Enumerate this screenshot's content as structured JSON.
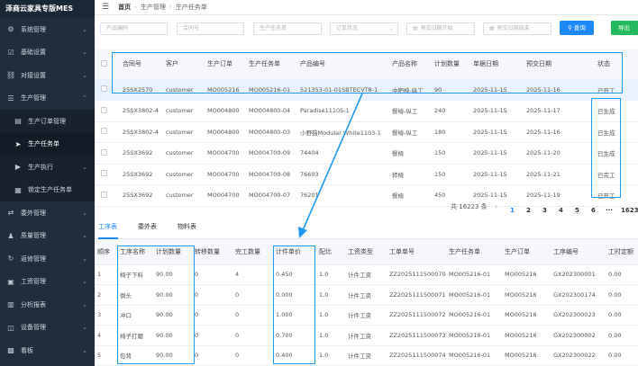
{
  "app": {
    "title": "泽商云家具专版MES"
  },
  "sidebar": {
    "items": [
      {
        "label": "系统管理",
        "icon": "gear-icon",
        "glyph": "⚙",
        "arrow": "⌄",
        "sub": false,
        "active": false
      },
      {
        "label": "基础设置",
        "icon": "checkbox-icon",
        "glyph": "☑",
        "arrow": "⌄",
        "sub": false,
        "active": false
      },
      {
        "label": "对接设置",
        "icon": "link-icon",
        "glyph": "⛓",
        "arrow": "⌄",
        "sub": false,
        "active": false
      },
      {
        "label": "生产管理",
        "icon": "layers-icon",
        "glyph": "☰",
        "arrow": "⌃",
        "sub": false,
        "active": false
      },
      {
        "label": "生产订单管理",
        "icon": "inbox-icon",
        "glyph": "▤",
        "arrow": "",
        "sub": true,
        "active": false
      },
      {
        "label": "生产任务单",
        "icon": "send-icon",
        "glyph": "➤",
        "arrow": "",
        "sub": true,
        "active": true
      },
      {
        "label": "生产执行",
        "icon": "play-circle-icon",
        "glyph": "▶",
        "arrow": "⌄",
        "sub": true,
        "active": false
      },
      {
        "label": "锁定生产任务单",
        "icon": "grid-icon",
        "glyph": "▦",
        "arrow": "",
        "sub": true,
        "active": false
      },
      {
        "label": "委外管理",
        "icon": "transfer-icon",
        "glyph": "⇄",
        "arrow": "⌄",
        "sub": false,
        "active": false
      },
      {
        "label": "质量管理",
        "icon": "user-check-icon",
        "glyph": "♟",
        "arrow": "⌄",
        "sub": false,
        "active": false
      },
      {
        "label": "返修管理",
        "icon": "refresh-icon",
        "glyph": "↻",
        "arrow": "⌄",
        "sub": false,
        "active": false
      },
      {
        "label": "工资管理",
        "icon": "wallet-icon",
        "glyph": "▣",
        "arrow": "⌄",
        "sub": false,
        "active": false
      },
      {
        "label": "分析报表",
        "icon": "chart-icon",
        "glyph": "▥",
        "arrow": "⌄",
        "sub": false,
        "active": false
      },
      {
        "label": "设备管理",
        "icon": "monitor-icon",
        "glyph": "◫",
        "arrow": "⌄",
        "sub": false,
        "active": false
      },
      {
        "label": "看板",
        "icon": "dashboard-icon",
        "glyph": "▩",
        "arrow": "⌄",
        "sub": false,
        "active": false
      }
    ]
  },
  "breadcrumb": {
    "home": "首页",
    "section": "生产管理",
    "page": "生产任务单"
  },
  "filters": {
    "product_code": "产品编码",
    "contract_no": "合同号",
    "task_no": "生产任务单",
    "order_status": "订单状态",
    "due_start": "预交日期开始",
    "due_end": "预交日期结束",
    "query_label": "查询",
    "export_label": "导出"
  },
  "upper_table": {
    "columns": [
      "",
      "合同号",
      "客户",
      "生产订单",
      "生产任务单",
      "产品编号",
      "产品名称",
      "计划数量",
      "单据日期",
      "预交日期",
      "状态"
    ],
    "rows": [
      [
        "25SX2570",
        "customer",
        "MO005216",
        "MO005216-01",
        "521353-01-01SBTECVT8-1",
        "中吧椅-纵工",
        "90",
        "2025-11-15",
        "2025-11-16",
        "已开工"
      ],
      [
        "25SX3802-4",
        "customer",
        "MO004800",
        "MO004800-04",
        "Paradise11105-1",
        "餐椅-纵工",
        "240",
        "2025-11-15",
        "2025-11-17",
        "已生成"
      ],
      [
        "25SX3802-4",
        "customer",
        "MO004800",
        "MO004800-03",
        "小野猫Modular White1103-1",
        "餐椅-纵工",
        "180",
        "2025-11-15",
        "2025-11-16",
        "已生成"
      ],
      [
        "25SX3692",
        "customer",
        "MO004700",
        "MO004700-09",
        "74404",
        "餐椅",
        "150",
        "2025-11-15",
        "2025-11-20",
        "已生成"
      ],
      [
        "25SX3692",
        "customer",
        "MO004700",
        "MO004700-08",
        "76603",
        "转椅",
        "150",
        "2025-11-15",
        "2025-11-21",
        "已完工"
      ],
      [
        "25SX3692",
        "customer",
        "MO004700",
        "MO004700-07",
        "76201",
        "餐椅",
        "450",
        "2025-11-15",
        "2025-11-19",
        "已开工"
      ]
    ]
  },
  "pagination": {
    "total": "共 16223 条",
    "prev": "‹",
    "pages": [
      "1",
      "2",
      "3",
      "4",
      "5",
      "6",
      "···",
      "1623"
    ],
    "current": "1"
  },
  "tabs": [
    "工序表",
    "委外表",
    "物料表"
  ],
  "lower_table": {
    "columns": [
      "顺序",
      "工序名称",
      "计划数量",
      "转移数量",
      "完工数量",
      "计件单价",
      "配比",
      "工资类型",
      "工单单号",
      "生产任务单",
      "生产订单",
      "工序编号",
      "工时定额"
    ],
    "rows": [
      [
        "1",
        "椅子下料",
        "90.00",
        "0",
        "4",
        "0.450",
        "1.0",
        "计件工资",
        "ZZ2025111500070",
        "MO005216-01",
        "MO005216",
        "GX202300001",
        "0.00"
      ],
      [
        "2",
        "倒头",
        "90.00",
        "0",
        "0",
        "0.000",
        "1.0",
        "计件工资",
        "ZZ2025111500071",
        "MO005216-01",
        "MO005216",
        "GX202300174",
        "0.00"
      ],
      [
        "3",
        "冲口",
        "90.00",
        "0",
        "0",
        "1.000",
        "1.0",
        "计件工资",
        "ZZ2025111500072",
        "MO005216-01",
        "MO005216",
        "GX202300023",
        "0.00"
      ],
      [
        "4",
        "椅子打磨",
        "90.00",
        "0",
        "0",
        "0.700",
        "1.0",
        "计件工资",
        "ZZ2025111500073",
        "MO005216-01",
        "MO005216",
        "GX202300002",
        "0.00"
      ],
      [
        "5",
        "包背",
        "90.00",
        "0",
        "0",
        "0.400",
        "1.0",
        "计件工资",
        "ZZ2025111500074",
        "MO005216-01",
        "MO005216",
        "GX202300022",
        "0.00"
      ]
    ]
  },
  "colors": {
    "accent": "#1e88f7",
    "export": "#23b95c",
    "sidebar_bg": "#1f2d3d",
    "highlight": "#1e9bf0"
  }
}
